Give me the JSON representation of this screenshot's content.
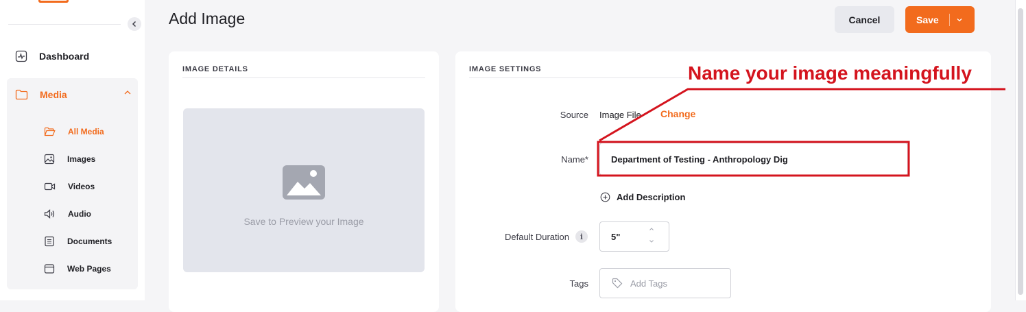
{
  "sidebar": {
    "dashboard_label": "Dashboard",
    "media_label": "Media",
    "items": [
      {
        "label": "All Media",
        "icon": "folder-icon",
        "active": true
      },
      {
        "label": "Images",
        "icon": "image-icon",
        "active": false
      },
      {
        "label": "Videos",
        "icon": "video-icon",
        "active": false
      },
      {
        "label": "Audio",
        "icon": "speaker-icon",
        "active": false
      },
      {
        "label": "Documents",
        "icon": "document-icon",
        "active": false
      },
      {
        "label": "Web Pages",
        "icon": "browser-window-icon",
        "active": false
      }
    ]
  },
  "header": {
    "title": "Add Image",
    "cancel_label": "Cancel",
    "save_label": "Save"
  },
  "details_card": {
    "heading": "IMAGE DETAILS",
    "preview_text": "Save to Preview your Image"
  },
  "settings_card": {
    "heading": "IMAGE SETTINGS",
    "source_label": "Source",
    "source_value": "Image File",
    "change_label": "Change",
    "name_label": "Name*",
    "name_value": "Department of Testing - Anthropology Dig",
    "add_description_label": "Add Description",
    "duration_label": "Default Duration",
    "info_glyph": "i",
    "duration_value": "5\"",
    "tags_label": "Tags",
    "tags_placeholder": "Add Tags"
  },
  "annotation": {
    "text": "Name your image meaningfully",
    "color": "#d4141e"
  },
  "colors": {
    "accent": "#f26b1d",
    "background": "#f5f5f7",
    "preview_bg": "#e3e5ec"
  }
}
